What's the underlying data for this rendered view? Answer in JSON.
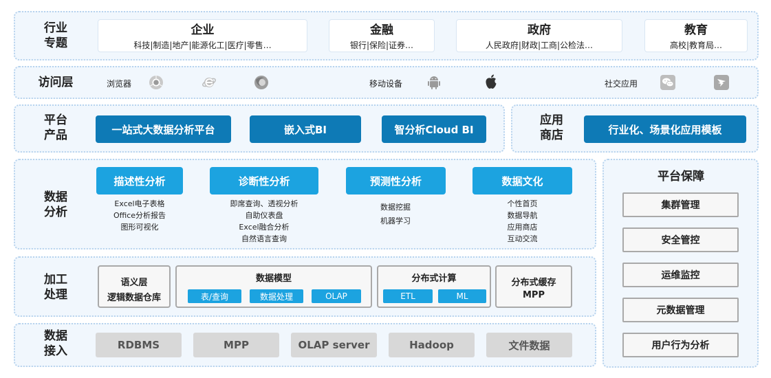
{
  "industry": {
    "label": "行业\n专题",
    "cards": [
      {
        "title": "企业",
        "sub": "科技|制造|地产|能源化工|医疗|零售…"
      },
      {
        "title": "金融",
        "sub": "银行|保险|证券…"
      },
      {
        "title": "政府",
        "sub": "人民政府|财政|工商|公检法…"
      },
      {
        "title": "教育",
        "sub": "高校|教育局…"
      }
    ]
  },
  "access": {
    "label": "访问层",
    "browser_label": "浏览器",
    "mobile_label": "移动设备",
    "social_label": "社交应用",
    "icons": [
      "chrome-icon",
      "ie-icon",
      "firefox-icon",
      "android-icon",
      "apple-icon",
      "wechat-icon",
      "dingtalk-icon"
    ]
  },
  "platform": {
    "label": "平台\n产品",
    "products": [
      "一站式大数据分析平台",
      "嵌入式BI",
      "智分析Cloud BI"
    ]
  },
  "store": {
    "label": "应用\n商店",
    "item": "行业化、场景化应用模板"
  },
  "analysis": {
    "label": "数据\n分析",
    "categories": [
      {
        "title": "描述性分析",
        "items": [
          "Excel电子表格",
          "Office分析报告",
          "图形可视化"
        ]
      },
      {
        "title": "诊断性分析",
        "items": [
          "即席查询、透视分析",
          "自助仪表盘",
          "Excel融合分析",
          "自然语言查询"
        ]
      },
      {
        "title": "预测性分析",
        "items": [
          "数据挖掘",
          "机器学习"
        ]
      },
      {
        "title": "数据文化",
        "items": [
          "个性首页",
          "数据导航",
          "应用商店",
          "互动交流"
        ]
      }
    ]
  },
  "processing": {
    "label": "加工\n处理",
    "semantic": {
      "line1": "语义层",
      "line2": "逻辑数据仓库"
    },
    "model": {
      "title": "数据模型",
      "chips": [
        "表/查询",
        "数据处理",
        "OLAP"
      ]
    },
    "compute": {
      "title": "分布式计算",
      "chips": [
        "ETL",
        "ML"
      ]
    },
    "cache": {
      "line1": "分布式缓存",
      "line2": "MPP"
    }
  },
  "ingest": {
    "label": "数据\n接入",
    "sources": [
      "RDBMS",
      "MPP",
      "OLAP server",
      "Hadoop",
      "文件数据"
    ]
  },
  "guarantee": {
    "title": "平台保障",
    "items": [
      "集群管理",
      "安全管控",
      "运维监控",
      "元数据管理",
      "用户行为分析"
    ]
  },
  "colors": {
    "dark_blue": "#0e7ab6",
    "sky_blue": "#1ca3e0",
    "panel_bg": "#f1f7fd",
    "panel_border": "#b7d3ee",
    "gray_chip": "#d8d8d8"
  }
}
